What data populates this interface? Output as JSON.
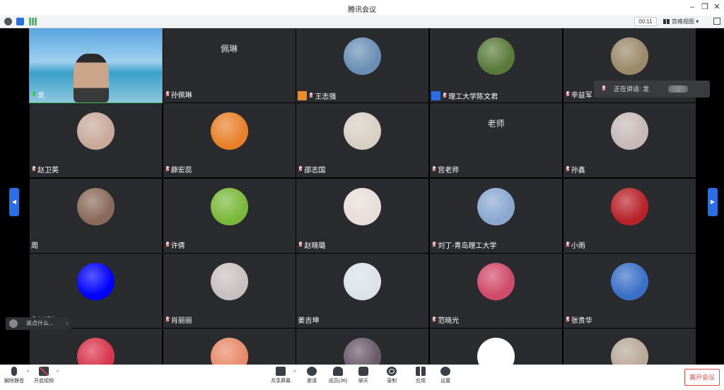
{
  "window": {
    "title": "腾讯会议",
    "minimize": "–",
    "restore": "❐",
    "close": "✕"
  },
  "infobar": {
    "timer": "00:11",
    "view_label": "宫格视图",
    "view_caret": "▾"
  },
  "speaking": {
    "label": "正在讲话: 龙"
  },
  "chat": {
    "placeholder": "说点什么...",
    "collapse": "‹"
  },
  "nav": {
    "left_arrow": "◀",
    "right_arrow": "▶"
  },
  "tiles": [
    {
      "name": "龙",
      "mic": "on",
      "video": true
    },
    {
      "name": "孙佩琳",
      "mic": "muted",
      "big": "佩琳"
    },
    {
      "name": "王志强",
      "mic": "muted",
      "avatar": "#6a8fb5",
      "badge": "#f08a24"
    },
    {
      "name": "理工大学陈文君",
      "mic": "muted",
      "avatar": "#5a7a3a",
      "badge": "#2a6ee6"
    },
    {
      "name": "辛益军",
      "mic": "muted",
      "avatar": "#9a8a6a"
    },
    {
      "name": "赵卫英",
      "mic": "muted",
      "avatar": "#c9a99a"
    },
    {
      "name": "薛宏蕊",
      "mic": "muted",
      "avatar": "#e8802a"
    },
    {
      "name": "邵志国",
      "mic": "muted",
      "avatar": "#d8cfc4"
    },
    {
      "name": "宫老师",
      "mic": "muted",
      "big": "老师"
    },
    {
      "name": "孙鑫",
      "mic": "muted",
      "avatar": "#c8b8b8"
    },
    {
      "name": "周",
      "mic": "none",
      "avatar": "#8a6a5a"
    },
    {
      "name": "许倩",
      "mic": "muted",
      "avatar": "#7ab83a"
    },
    {
      "name": "赵晓璐",
      "mic": "muted",
      "avatar": "#e8ddd8"
    },
    {
      "name": "刘丁-青岛理工大学",
      "mic": "muted",
      "avatar": "#8aa8d0"
    },
    {
      "name": "小雨",
      "mic": "muted",
      "avatar": "#b8232a"
    },
    {
      "name": "刘禄亿",
      "mic": "muted",
      "avatar": "#0000ff"
    },
    {
      "name": "肖丽丽",
      "mic": "muted",
      "avatar": "#c8c0c0"
    },
    {
      "name": "姜吉坤",
      "mic": "none",
      "avatar": "#dde2e6"
    },
    {
      "name": "范晓光",
      "mic": "muted",
      "avatar": "#d04a6a"
    },
    {
      "name": "张贵华",
      "mic": "muted",
      "avatar": "#3a70c8"
    },
    {
      "name": "",
      "mic": "none",
      "avatar": "#d8344a"
    },
    {
      "name": "",
      "mic": "none",
      "avatar": "#e88a6a"
    },
    {
      "name": "",
      "mic": "none",
      "avatar": "#6a5a6a"
    },
    {
      "name": "",
      "mic": "none",
      "avatar": "#ffffff"
    },
    {
      "name": "",
      "mic": "none",
      "avatar": "#b8a898"
    }
  ],
  "toolbar": {
    "unmute": "解除静音",
    "start_video": "开启视频",
    "share_screen": "共享屏幕",
    "invite": "邀请",
    "members": "成员(36)",
    "chat": "聊天",
    "record": "录制",
    "apps": "应用",
    "settings": "设置",
    "leave": "离开会议",
    "caret": "^"
  },
  "colors": {
    "accent": "#2a6ee6",
    "danger": "#e34a4a",
    "tile_bg": "#2a2b2e"
  }
}
